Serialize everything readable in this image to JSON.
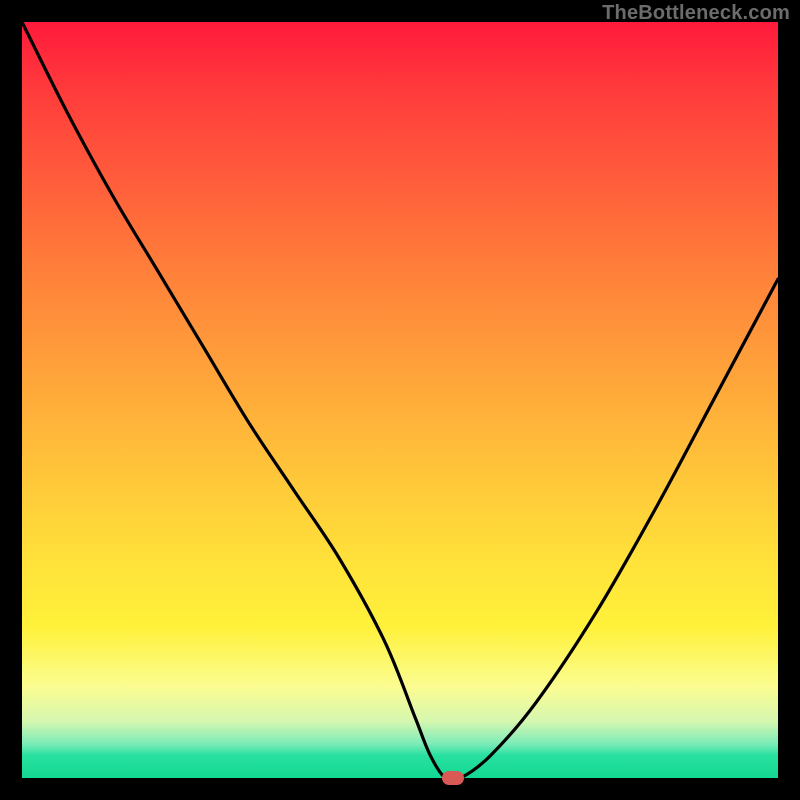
{
  "watermark": "TheBottleneck.com",
  "chart_data": {
    "type": "line",
    "title": "",
    "xlabel": "",
    "ylabel": "",
    "xlim": [
      0,
      100
    ],
    "ylim": [
      0,
      100
    ],
    "series": [
      {
        "name": "bottleneck-curve",
        "x": [
          0,
          6,
          12,
          18,
          24,
          30,
          36,
          42,
          48,
          52,
          54,
          56,
          58,
          62,
          68,
          76,
          84,
          92,
          100
        ],
        "values": [
          100,
          88,
          77,
          67,
          57,
          47,
          38,
          29,
          18,
          8,
          3,
          0,
          0,
          3,
          10,
          22,
          36,
          51,
          66
        ]
      }
    ],
    "marker": {
      "x": 57,
      "y": 0
    },
    "background_gradient": {
      "top": "#ff1a3c",
      "mid": "#ffe33a",
      "bottom": "#13d992"
    }
  }
}
